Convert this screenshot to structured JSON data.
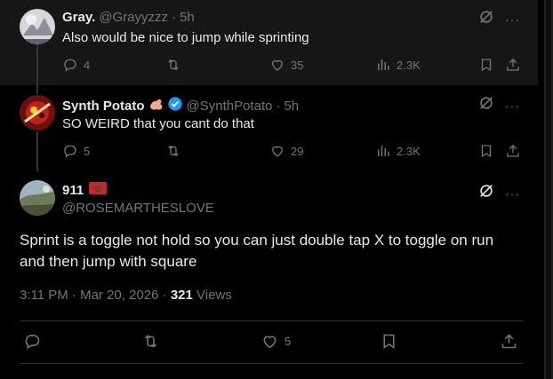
{
  "replies": [
    {
      "name": "Gray.",
      "handle": "@Grayyzzz",
      "time": "5h",
      "text": "Also would be nice to jump while sprinting",
      "replies": "4",
      "likes": "35",
      "views": "2.3K"
    },
    {
      "name": "Synth Potato",
      "handle": "@SynthPotato",
      "time": "5h",
      "text": "SO WEIRD that you cant do that",
      "replies": "5",
      "likes": "29",
      "views": "2.3K"
    }
  ],
  "main": {
    "name": "911",
    "handle": "@ROSEMARTHESLOVE",
    "text": "Sprint is a toggle not hold so you can just double tap X to toggle on run and then jump with square",
    "time": "3:11 PM",
    "date": "Mar 20, 2026",
    "views_count": "321",
    "views_label": "Views",
    "likes": "5"
  },
  "separator": "·",
  "more_glyph": "···",
  "colors": {
    "background": "#000000",
    "hover_row": "#161616",
    "muted": "#71767b",
    "verified": "#1d9bf0",
    "text": "#e7e9ea"
  }
}
